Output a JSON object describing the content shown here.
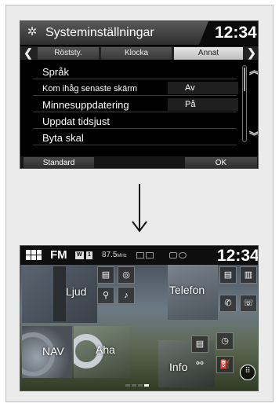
{
  "settings_screen": {
    "title": "Systeminställningar",
    "clock": "12:34",
    "gear_icon": "gear-icon",
    "tabs": [
      {
        "label": "Röststy.",
        "active": false
      },
      {
        "label": "Klocka",
        "active": false
      },
      {
        "label": "Annat",
        "active": true
      }
    ],
    "items": [
      {
        "label": "Språk",
        "value": ""
      },
      {
        "label": "Kom ihåg senaste skärm",
        "value": "Av"
      },
      {
        "label": "Minnesuppdatering",
        "value": "På"
      },
      {
        "label": "Uppdat tidsjust",
        "value": ""
      },
      {
        "label": "Byta skal",
        "value": ""
      }
    ],
    "buttons": {
      "default": "Standard",
      "ok": "OK"
    }
  },
  "home_screen": {
    "source": "FM",
    "badge_1": "W",
    "badge_2": "1",
    "frequency": "87.5",
    "frequency_unit": "MHz",
    "clock": "12:34",
    "tiles": {
      "audio": "Ljud",
      "phone": "Telefon",
      "nav": "NAV",
      "aha": "Aha",
      "info": "Info"
    }
  },
  "colors": {
    "screen_bg": "#000000",
    "active_tab": "#d4d4d4",
    "page_bg": "#ebebeb"
  }
}
